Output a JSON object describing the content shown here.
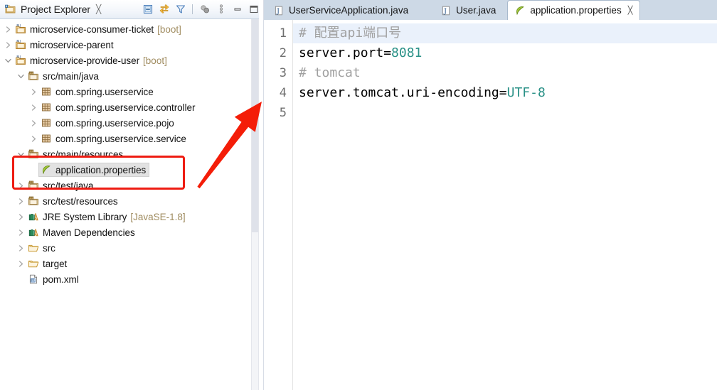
{
  "explorer": {
    "title": "Project Explorer",
    "close_icon": "close-icon",
    "toolbar": [
      {
        "name": "collapse-all-icon",
        "label": "Collapse All"
      },
      {
        "name": "link-with-editor-icon",
        "label": "Link with Editor"
      },
      {
        "name": "filter-icon",
        "label": "View Menu Filters"
      },
      {
        "name": "focus-on-active-task-icon",
        "label": "Focus on Active Task"
      },
      {
        "name": "view-menu-icon",
        "label": "View Menu"
      },
      {
        "name": "minimize-icon",
        "label": "Minimize"
      },
      {
        "name": "maximize-icon",
        "label": "Maximize"
      }
    ],
    "tree": [
      {
        "indent": 0,
        "twisty": "collapsed",
        "icon": "maven-java-project-icon",
        "label": "microservice-consumer-ticket",
        "suffix": "[boot]",
        "selected": false
      },
      {
        "indent": 0,
        "twisty": "collapsed",
        "icon": "maven-java-project-icon",
        "label": "microservice-parent",
        "suffix": "",
        "selected": false
      },
      {
        "indent": 0,
        "twisty": "expanded",
        "icon": "maven-java-project-icon",
        "label": "microservice-provide-user",
        "suffix": "[boot]",
        "selected": false
      },
      {
        "indent": 1,
        "twisty": "expanded",
        "icon": "source-folder-icon",
        "label": "src/main/java",
        "suffix": "",
        "selected": false
      },
      {
        "indent": 2,
        "twisty": "collapsed",
        "icon": "package-icon",
        "label": "com.spring.userservice",
        "suffix": "",
        "selected": false
      },
      {
        "indent": 2,
        "twisty": "collapsed",
        "icon": "package-icon",
        "label": "com.spring.userservice.controller",
        "suffix": "",
        "selected": false
      },
      {
        "indent": 2,
        "twisty": "collapsed",
        "icon": "package-icon",
        "label": "com.spring.userservice.pojo",
        "suffix": "",
        "selected": false
      },
      {
        "indent": 2,
        "twisty": "collapsed",
        "icon": "package-icon",
        "label": "com.spring.userservice.service",
        "suffix": "",
        "selected": false
      },
      {
        "indent": 1,
        "twisty": "expanded",
        "icon": "source-folder-icon",
        "label": "src/main/resources",
        "suffix": "",
        "selected": false
      },
      {
        "indent": 2,
        "twisty": "none",
        "icon": "properties-file-icon",
        "label": "application.properties",
        "suffix": "",
        "selected": true
      },
      {
        "indent": 1,
        "twisty": "collapsed",
        "icon": "source-folder-icon",
        "label": "src/test/java",
        "suffix": "",
        "selected": false
      },
      {
        "indent": 1,
        "twisty": "collapsed",
        "icon": "source-folder-icon",
        "label": "src/test/resources",
        "suffix": "",
        "selected": false
      },
      {
        "indent": 1,
        "twisty": "collapsed",
        "icon": "library-icon",
        "label": "JRE System Library",
        "suffix": "[JavaSE-1.8]",
        "selected": false
      },
      {
        "indent": 1,
        "twisty": "collapsed",
        "icon": "library-icon",
        "label": "Maven Dependencies",
        "suffix": "",
        "selected": false
      },
      {
        "indent": 1,
        "twisty": "collapsed",
        "icon": "folder-icon",
        "label": "src",
        "suffix": "",
        "selected": false
      },
      {
        "indent": 1,
        "twisty": "collapsed",
        "icon": "folder-icon",
        "label": "target",
        "suffix": "",
        "selected": false
      },
      {
        "indent": 1,
        "twisty": "none",
        "icon": "maven-pom-icon",
        "label": "pom.xml",
        "suffix": "",
        "selected": false
      }
    ]
  },
  "editor": {
    "tabs": [
      {
        "label": "UserServiceApplication.java",
        "icon": "java-file-icon",
        "active": false,
        "closable": false
      },
      {
        "label": "User.java",
        "icon": "java-file-icon",
        "active": false,
        "closable": false
      },
      {
        "label": "application.properties",
        "icon": "properties-file-icon",
        "active": true,
        "closable": true,
        "close_icon": "close-icon"
      }
    ],
    "line_numbers": [
      "1",
      "2",
      "3",
      "4",
      "5"
    ],
    "lines": [
      {
        "current": true,
        "tokens": [
          {
            "t": "comment",
            "v": "# 配置api端口号"
          }
        ]
      },
      {
        "current": false,
        "tokens": [
          {
            "t": "key",
            "v": "server.port="
          },
          {
            "t": "value",
            "v": "8081"
          }
        ]
      },
      {
        "current": false,
        "tokens": [
          {
            "t": "comment",
            "v": "# tomcat"
          }
        ]
      },
      {
        "current": false,
        "tokens": [
          {
            "t": "key",
            "v": "server.tomcat.uri-encoding="
          },
          {
            "t": "value",
            "v": "UTF-8"
          }
        ]
      },
      {
        "current": false,
        "tokens": [
          {
            "t": "key",
            "v": ""
          }
        ]
      }
    ]
  },
  "annotations": {
    "highlight_color": "#ee1c12",
    "arrow_color": "#f41d08",
    "highlight_target": "src/main/resources / application.properties",
    "arrow_points_to": "application.properties editor tab"
  },
  "colors": {
    "tabstrip_bg": "#cdd9e6",
    "selection_bg": "#e2e2e2",
    "current_line_bg": "#eaf1fb",
    "comment": "#a0a0a0",
    "value": "#2a9187",
    "suffix": "#a08c60"
  }
}
